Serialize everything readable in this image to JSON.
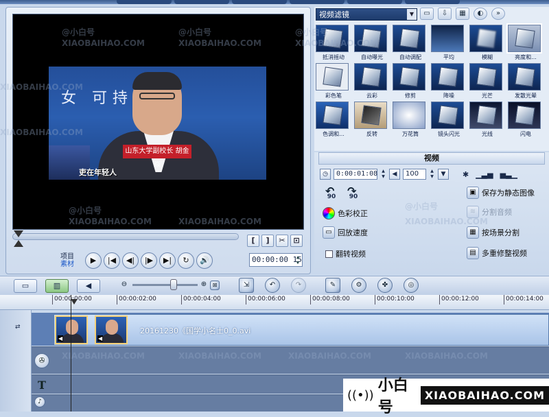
{
  "preview": {
    "video_banner": "女  可持续",
    "name_tag": "山东大学副校长 胡金焱",
    "subtitle": "吏在年轻人",
    "mode_project": "项目",
    "mode_material": "素材",
    "timecode": "00:00:00 15",
    "trim_buttons": [
      "[",
      "]",
      "✂",
      "⊡"
    ],
    "transport": [
      "▶",
      "|◀",
      "◀|",
      "|▶",
      "▶|",
      "↻",
      "🔊"
    ]
  },
  "library": {
    "dropdown_value": "视频滤镜",
    "tools": [
      "folder-icon",
      "import-icon",
      "options-icon",
      "refresh-icon",
      "expand-icon"
    ],
    "thumbnails": [
      [
        "抵消摇动",
        "自动曝光",
        "自动调配",
        "平均",
        "模糊",
        "亮度和..."
      ],
      [
        "彩色笔",
        "云彩",
        "修剪",
        "降噪",
        "光芒",
        "发散光晕"
      ],
      [
        "色调和...",
        "反转",
        "万花筒",
        "镜头闪光",
        "光线",
        "闪电"
      ]
    ]
  },
  "options": {
    "tab_label": "视频",
    "duration": "0:00:01:08",
    "volume": "100",
    "rotate_left": "90",
    "rotate_right": "90",
    "items": {
      "color_correction": "色彩校正",
      "playback_speed": "回放速度",
      "reverse_video": "翻转视频",
      "save_still": "保存为静态图像",
      "split_audio": "分割音频",
      "split_by_scene": "按场景分割",
      "multi_trim": "多重修整视频"
    }
  },
  "timeline": {
    "ruler_ticks": [
      "00:00:00:00",
      "00:00:02:00",
      "00:00:04:00",
      "00:00:06:00",
      "00:00:08:00",
      "00:00:10:00",
      "00:00:12:00",
      "00:00:14:00"
    ],
    "clip_name": "20161230《国学小名士0_0.avi"
  },
  "watermark": {
    "cn": "@小白号",
    "en": "XIAOBAIHAO.COM"
  },
  "brand": {
    "signal": "((•))",
    "cn": "小白号",
    "en": "XIAOBAIHAO.COM"
  }
}
